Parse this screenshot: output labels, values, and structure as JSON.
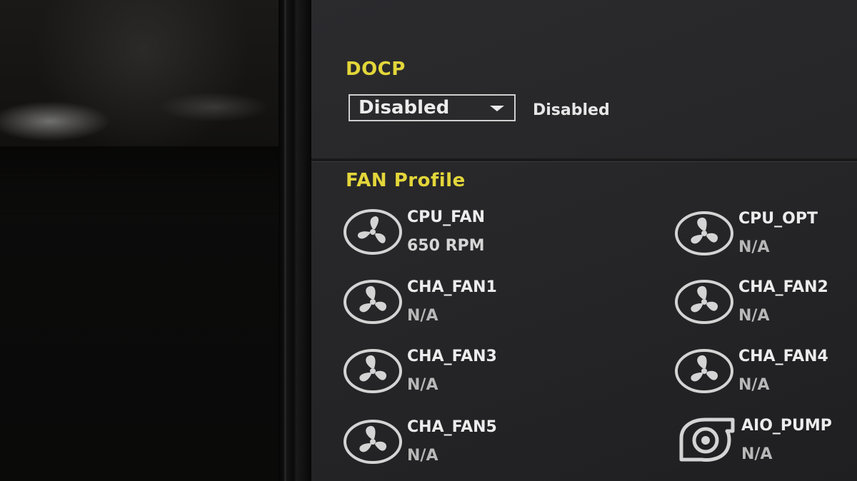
{
  "docp": {
    "title": "DOCP",
    "select_value": "Disabled",
    "current_value": "Disabled"
  },
  "fan_profile": {
    "title": "FAN Profile",
    "fans": [
      {
        "name": "CPU_FAN",
        "reading": "650 RPM",
        "icon": "fan-icon"
      },
      {
        "name": "CPU_OPT",
        "reading": "N/A",
        "icon": "fan-icon"
      },
      {
        "name": "CHA_FAN1",
        "reading": "N/A",
        "icon": "fan-icon"
      },
      {
        "name": "CHA_FAN2",
        "reading": "N/A",
        "icon": "fan-icon"
      },
      {
        "name": "CHA_FAN3",
        "reading": "N/A",
        "icon": "fan-icon"
      },
      {
        "name": "CHA_FAN4",
        "reading": "N/A",
        "icon": "fan-icon"
      },
      {
        "name": "CHA_FAN5",
        "reading": "N/A",
        "icon": "fan-icon"
      },
      {
        "name": "AIO_PUMP",
        "reading": "N/A",
        "icon": "pump-icon"
      }
    ]
  },
  "colors": {
    "section_title": "#e3d63a",
    "text": "#ececec",
    "panel": "#2a2a2c"
  }
}
